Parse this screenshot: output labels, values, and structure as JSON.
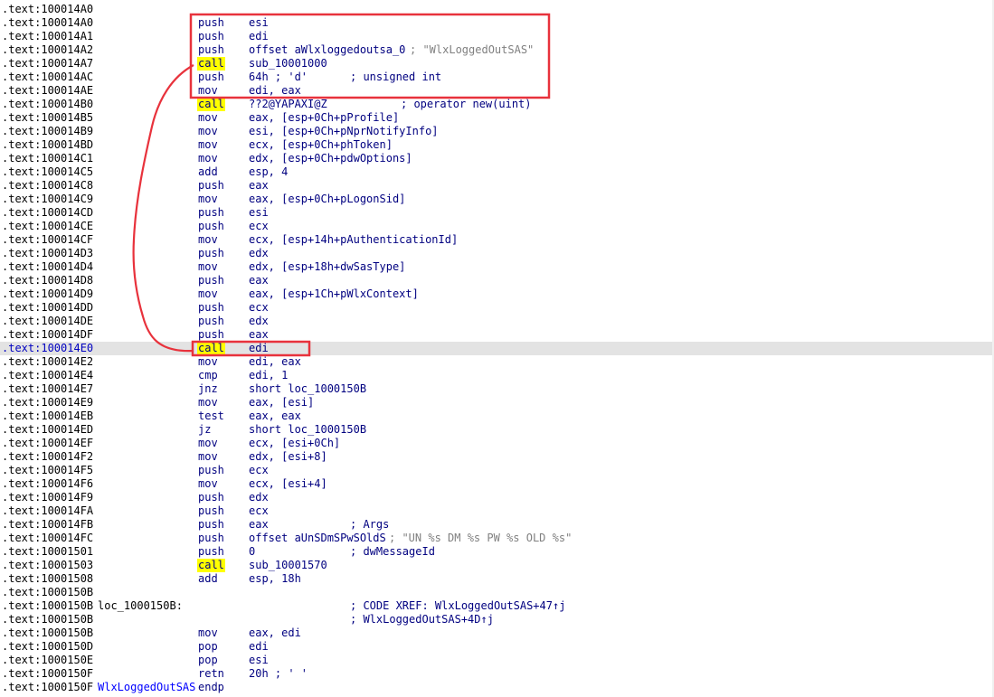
{
  "lines": [
    {
      "addr": ".text:100014A0",
      "label": "",
      "mn": "",
      "ops": "",
      "comment": ""
    },
    {
      "addr": ".text:100014A0",
      "label": "",
      "mn": "push",
      "ops": "esi",
      "comment": ""
    },
    {
      "addr": ".text:100014A1",
      "label": "",
      "mn": "push",
      "ops": "edi",
      "comment": ""
    },
    {
      "addr": ".text:100014A2",
      "label": "",
      "mn": "push",
      "ops": "offset aWlxloggedoutsa_0",
      "comment": "; \"WlxLoggedOutSAS\""
    },
    {
      "addr": ".text:100014A7",
      "label": "",
      "mn": "call",
      "ops": "sub_10001000",
      "comment": ""
    },
    {
      "addr": ".text:100014AC",
      "label": "",
      "mn": "push",
      "ops": "64h ; 'd'",
      "comment": "; unsigned int"
    },
    {
      "addr": ".text:100014AE",
      "label": "",
      "mn": "mov",
      "ops": "edi, eax",
      "comment": ""
    },
    {
      "addr": ".text:100014B0",
      "label": "",
      "mn": "call",
      "ops": "??2@YAPAXI@Z",
      "comment": "; operator new(uint)"
    },
    {
      "addr": ".text:100014B5",
      "label": "",
      "mn": "mov",
      "ops": "eax, [esp+0Ch+pProfile]",
      "comment": ""
    },
    {
      "addr": ".text:100014B9",
      "label": "",
      "mn": "mov",
      "ops": "esi, [esp+0Ch+pNprNotifyInfo]",
      "comment": ""
    },
    {
      "addr": ".text:100014BD",
      "label": "",
      "mn": "mov",
      "ops": "ecx, [esp+0Ch+phToken]",
      "comment": ""
    },
    {
      "addr": ".text:100014C1",
      "label": "",
      "mn": "mov",
      "ops": "edx, [esp+0Ch+pdwOptions]",
      "comment": ""
    },
    {
      "addr": ".text:100014C5",
      "label": "",
      "mn": "add",
      "ops": "esp, 4",
      "comment": ""
    },
    {
      "addr": ".text:100014C8",
      "label": "",
      "mn": "push",
      "ops": "eax",
      "comment": ""
    },
    {
      "addr": ".text:100014C9",
      "label": "",
      "mn": "mov",
      "ops": "eax, [esp+0Ch+pLogonSid]",
      "comment": ""
    },
    {
      "addr": ".text:100014CD",
      "label": "",
      "mn": "push",
      "ops": "esi",
      "comment": ""
    },
    {
      "addr": ".text:100014CE",
      "label": "",
      "mn": "push",
      "ops": "ecx",
      "comment": ""
    },
    {
      "addr": ".text:100014CF",
      "label": "",
      "mn": "mov",
      "ops": "ecx, [esp+14h+pAuthenticationId]",
      "comment": ""
    },
    {
      "addr": ".text:100014D3",
      "label": "",
      "mn": "push",
      "ops": "edx",
      "comment": ""
    },
    {
      "addr": ".text:100014D4",
      "label": "",
      "mn": "mov",
      "ops": "edx, [esp+18h+dwSasType]",
      "comment": ""
    },
    {
      "addr": ".text:100014D8",
      "label": "",
      "mn": "push",
      "ops": "eax",
      "comment": ""
    },
    {
      "addr": ".text:100014D9",
      "label": "",
      "mn": "mov",
      "ops": "eax, [esp+1Ch+pWlxContext]",
      "comment": ""
    },
    {
      "addr": ".text:100014DD",
      "label": "",
      "mn": "push",
      "ops": "ecx",
      "comment": ""
    },
    {
      "addr": ".text:100014DE",
      "label": "",
      "mn": "push",
      "ops": "edx",
      "comment": ""
    },
    {
      "addr": ".text:100014DF",
      "label": "",
      "mn": "push",
      "ops": "eax",
      "comment": ""
    },
    {
      "addr": ".text:100014E0",
      "label": "",
      "mn": "call",
      "ops": "edi",
      "comment": "",
      "highlight": true
    },
    {
      "addr": ".text:100014E2",
      "label": "",
      "mn": "mov",
      "ops": "edi, eax",
      "comment": ""
    },
    {
      "addr": ".text:100014E4",
      "label": "",
      "mn": "cmp",
      "ops": "edi, 1",
      "comment": ""
    },
    {
      "addr": ".text:100014E7",
      "label": "",
      "mn": "jnz",
      "ops": "short loc_1000150B",
      "comment": ""
    },
    {
      "addr": ".text:100014E9",
      "label": "",
      "mn": "mov",
      "ops": "eax, [esi]",
      "comment": ""
    },
    {
      "addr": ".text:100014EB",
      "label": "",
      "mn": "test",
      "ops": "eax, eax",
      "comment": ""
    },
    {
      "addr": ".text:100014ED",
      "label": "",
      "mn": "jz",
      "ops": "short loc_1000150B",
      "comment": ""
    },
    {
      "addr": ".text:100014EF",
      "label": "",
      "mn": "mov",
      "ops": "ecx, [esi+0Ch]",
      "comment": ""
    },
    {
      "addr": ".text:100014F2",
      "label": "",
      "mn": "mov",
      "ops": "edx, [esi+8]",
      "comment": ""
    },
    {
      "addr": ".text:100014F5",
      "label": "",
      "mn": "push",
      "ops": "ecx",
      "comment": ""
    },
    {
      "addr": ".text:100014F6",
      "label": "",
      "mn": "mov",
      "ops": "ecx, [esi+4]",
      "comment": ""
    },
    {
      "addr": ".text:100014F9",
      "label": "",
      "mn": "push",
      "ops": "edx",
      "comment": ""
    },
    {
      "addr": ".text:100014FA",
      "label": "",
      "mn": "push",
      "ops": "ecx",
      "comment": ""
    },
    {
      "addr": ".text:100014FB",
      "label": "",
      "mn": "push",
      "ops": "eax",
      "comment": "; Args"
    },
    {
      "addr": ".text:100014FC",
      "label": "",
      "mn": "push",
      "ops": "offset aUnSDmSPwSOldS",
      "comment": "; \"UN %s DM %s PW %s OLD %s\""
    },
    {
      "addr": ".text:10001501",
      "label": "",
      "mn": "push",
      "ops": "0",
      "comment": "; dwMessageId"
    },
    {
      "addr": ".text:10001503",
      "label": "",
      "mn": "call",
      "ops": "sub_10001570",
      "comment": ""
    },
    {
      "addr": ".text:10001508",
      "label": "",
      "mn": "add",
      "ops": "esp, 18h",
      "comment": ""
    },
    {
      "addr": ".text:1000150B",
      "label": "",
      "mn": "",
      "ops": "",
      "comment": ""
    },
    {
      "addr": ".text:1000150B",
      "label": "loc_1000150B:",
      "mn": "",
      "ops": "",
      "comment": "; CODE XREF: WlxLoggedOutSAS+47↑j"
    },
    {
      "addr": ".text:1000150B",
      "label": "",
      "mn": "",
      "ops": "",
      "comment": "; WlxLoggedOutSAS+4D↑j"
    },
    {
      "addr": ".text:1000150B",
      "label": "",
      "mn": "mov",
      "ops": "eax, edi",
      "comment": ""
    },
    {
      "addr": ".text:1000150D",
      "label": "",
      "mn": "pop",
      "ops": "edi",
      "comment": ""
    },
    {
      "addr": ".text:1000150E",
      "label": "",
      "mn": "pop",
      "ops": "esi",
      "comment": ""
    },
    {
      "addr": ".text:1000150F",
      "label": "",
      "mn": "retn",
      "ops": "20h ; ' '",
      "comment": ""
    },
    {
      "addr": ".text:1000150F",
      "label": "WlxLoggedOutSAS",
      "label_blue": true,
      "mn": "endp",
      "ops": "",
      "comment": ""
    }
  ],
  "colors": {
    "annotation": "#e8323c",
    "call_highlight": "#ffff00",
    "current_line": "#e3e3e3"
  }
}
